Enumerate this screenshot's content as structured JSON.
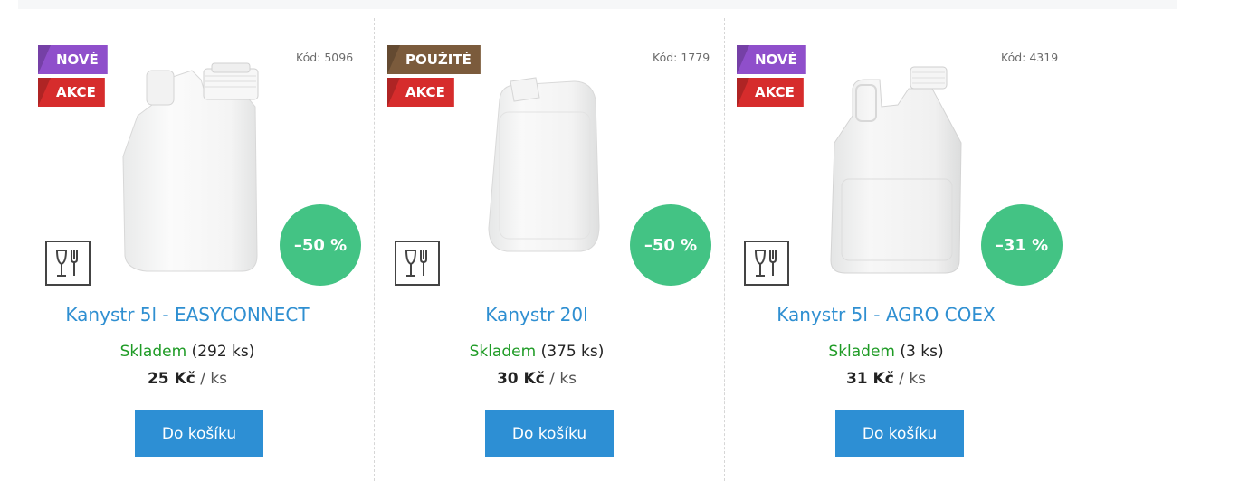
{
  "products": [
    {
      "code": "Kód: 5096",
      "flags": [
        "NOVÉ",
        "AKCE"
      ],
      "discount": "–50 %",
      "name": "Kanystr 5l - EASYCONNECT",
      "stock_status": "Skladem",
      "stock_count": "(292 ks)",
      "price": "25 Kč",
      "unit": "/ ks",
      "cart_label": "Do košíku",
      "food_safe_icon": "glass-fork-icon"
    },
    {
      "code": "Kód: 1779",
      "flags": [
        "POUŽITÉ",
        "AKCE"
      ],
      "discount": "–50 %",
      "name": "Kanystr 20l",
      "stock_status": "Skladem",
      "stock_count": "(375 ks)",
      "price": "30 Kč",
      "unit": "/ ks",
      "cart_label": "Do košíku",
      "food_safe_icon": "glass-fork-icon"
    },
    {
      "code": "Kód: 4319",
      "flags": [
        "NOVÉ",
        "AKCE"
      ],
      "discount": "–31 %",
      "name": "Kanystr 5l - AGRO COEX",
      "stock_status": "Skladem",
      "stock_count": "(3 ks)",
      "price": "31 Kč",
      "unit": "/ ks",
      "cart_label": "Do košíku",
      "food_safe_icon": "glass-fork-icon"
    }
  ],
  "colors": {
    "flag_new": "#8f4fcb",
    "flag_used": "#7b5b3c",
    "flag_sale": "#d62c2c",
    "discount": "#43c384",
    "link": "#2f8fd1",
    "stock_ok": "#1e9b25",
    "button": "#2d8fd4"
  }
}
